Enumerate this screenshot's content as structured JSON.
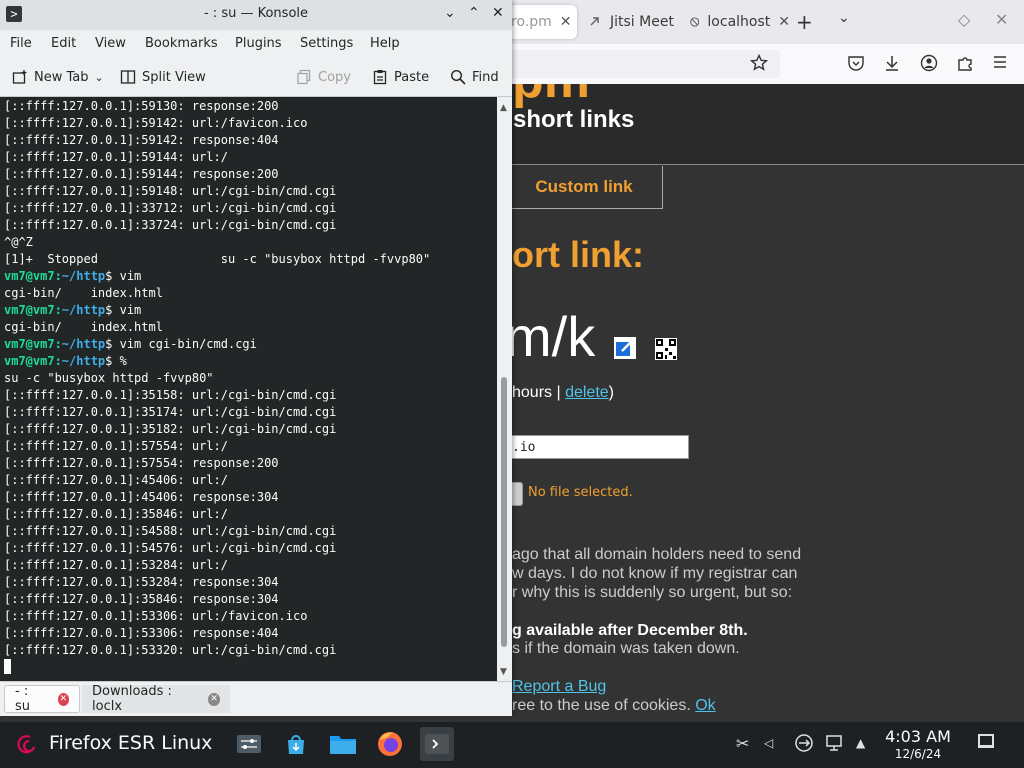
{
  "firefox": {
    "tabs": [
      {
        "label": "ro.pm",
        "close": "✕"
      },
      {
        "label": "Jitsi Meet"
      },
      {
        "label": "localhost",
        "close": "✕"
      }
    ],
    "new_tab": "+",
    "list_all": "⌄",
    "page": {
      "site_logo": "pm",
      "site_subtitle": "short links",
      "custom_link_tab": "Custom link",
      "short_link_heading": "ort link:",
      "short_url": "m/k",
      "expiry_prefix": "hours | ",
      "delete_link": "delete",
      "expiry_suffix": ")",
      "url_input_value": ".io",
      "file_status": "No file selected.",
      "notice_lines": [
        "ago that all domain holders need to send",
        "w days. I do not know if my registrar can",
        "r why this is suddenly so urgent, but so:"
      ],
      "notice_bold": "g available after December 8th.",
      "notice_2": "s if the domain was taken down.",
      "report_bug": "Report a Bug",
      "cookie_text": "ree to the use of cookies. ",
      "cookie_ok": "Ok"
    }
  },
  "konsole": {
    "title": "- : su — Konsole",
    "app_icon": ">",
    "window_buttons": {
      "minimize": "⌄",
      "maximize": "⌃",
      "close": "✕"
    },
    "menu": [
      "File",
      "Edit",
      "View",
      "Bookmarks",
      "Plugins",
      "Settings",
      "Help"
    ],
    "toolbar": {
      "new_tab": "New Tab",
      "split_view": "Split View",
      "copy": "Copy",
      "paste": "Paste",
      "find": "Find"
    },
    "terminal_lines": [
      "[::ffff:127.0.0.1]:59130: response:200",
      "[::ffff:127.0.0.1]:59142: url:/favicon.ico",
      "[::ffff:127.0.0.1]:59142: response:404",
      "[::ffff:127.0.0.1]:59144: url:/",
      "[::ffff:127.0.0.1]:59144: response:200",
      "[::ffff:127.0.0.1]:59148: url:/cgi-bin/cmd.cgi",
      "[::ffff:127.0.0.1]:33712: url:/cgi-bin/cmd.cgi",
      "[::ffff:127.0.0.1]:33724: url:/cgi-bin/cmd.cgi",
      "^@^Z",
      "[1]+  Stopped                 su -c \"busybox httpd -fvvp80\"",
      {
        "user": "vm7@vm7",
        "path": "~/http",
        "cmd": "$ vim"
      },
      "cgi-bin/    index.html",
      {
        "user": "vm7@vm7",
        "path": "~/http",
        "cmd": "$ vim"
      },
      "cgi-bin/    index.html",
      {
        "user": "vm7@vm7",
        "path": "~/http",
        "cmd": "$ vim cgi-bin/cmd.cgi"
      },
      {
        "user": "vm7@vm7",
        "path": "~/http",
        "cmd": "$ %"
      },
      "su -c \"busybox httpd -fvvp80\"",
      "[::ffff:127.0.0.1]:35158: url:/cgi-bin/cmd.cgi",
      "[::ffff:127.0.0.1]:35174: url:/cgi-bin/cmd.cgi",
      "[::ffff:127.0.0.1]:35182: url:/cgi-bin/cmd.cgi",
      "[::ffff:127.0.0.1]:57554: url:/",
      "[::ffff:127.0.0.1]:57554: response:200",
      "[::ffff:127.0.0.1]:45406: url:/",
      "[::ffff:127.0.0.1]:45406: response:304",
      "[::ffff:127.0.0.1]:35846: url:/",
      "[::ffff:127.0.0.1]:54588: url:/cgi-bin/cmd.cgi",
      "[::ffff:127.0.0.1]:54576: url:/cgi-bin/cmd.cgi",
      "[::ffff:127.0.0.1]:53284: url:/",
      "[::ffff:127.0.0.1]:53284: response:304",
      "[::ffff:127.0.0.1]:35846: response:304",
      "[::ffff:127.0.0.1]:53306: url:/favicon.ico",
      "[::ffff:127.0.0.1]:53306: response:404",
      "[::ffff:127.0.0.1]:53320: url:/cgi-bin/cmd.cgi"
    ],
    "tabs": [
      {
        "label": "- : su",
        "active": true
      },
      {
        "label": "Downloads : loclx",
        "active": false
      }
    ]
  },
  "taskbar": {
    "active_window_title": "Firefox ESR Linux",
    "clock_time": "4:03 AM",
    "clock_date": "12/6/24"
  },
  "colors": {
    "terminal_bg": "#232627",
    "prompt_user": "#1cdc9a",
    "prompt_path": "#3daee9",
    "site_accent": "#f0a030",
    "link": "#4fc3e8"
  }
}
